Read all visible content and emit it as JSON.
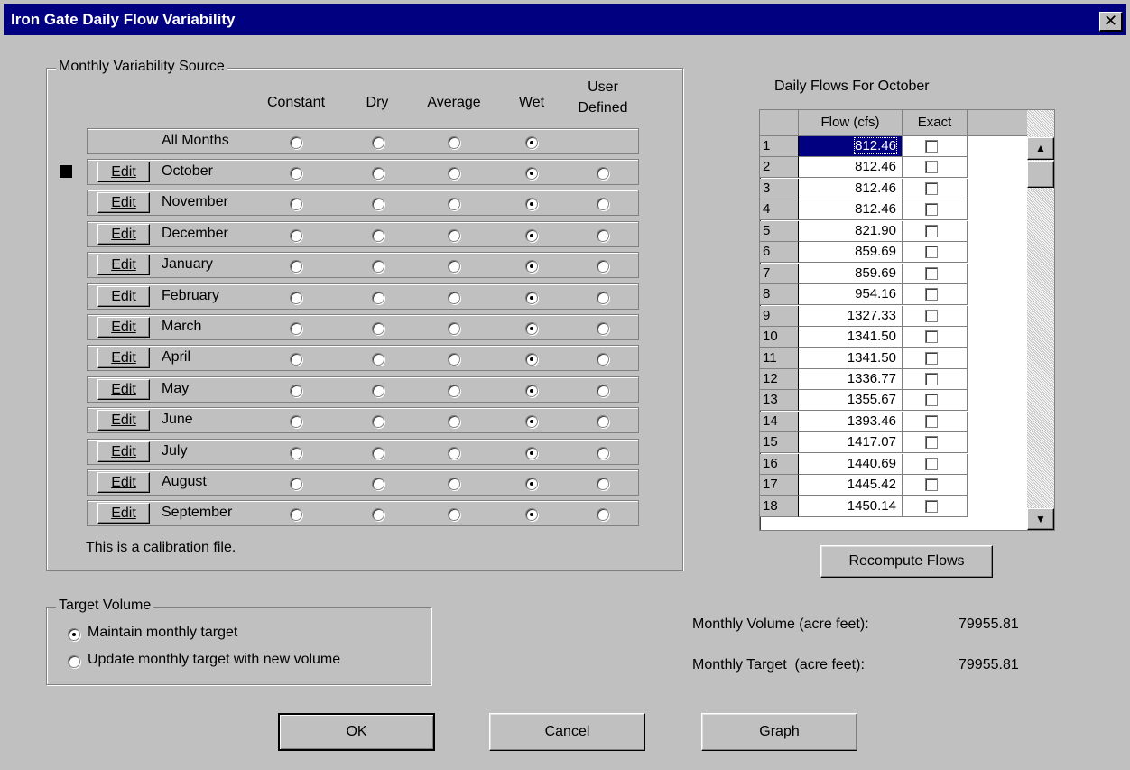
{
  "window": {
    "title": "Iron Gate Daily Flow Variability",
    "close_label": "✕"
  },
  "variability": {
    "group_label": "Monthly Variability Source",
    "columns": [
      "Constant",
      "Dry",
      "Average",
      "Wet",
      "User Defined"
    ],
    "column_user_line1": "User",
    "column_user_line2": "Defined",
    "all_months_label": "All Months",
    "edit_label": "Edit",
    "months": [
      "October",
      "November",
      "December",
      "January",
      "February",
      "March",
      "April",
      "May",
      "June",
      "July",
      "August",
      "September"
    ],
    "selected_source": "Wet",
    "current_month": "October",
    "note": "This is a calibration file."
  },
  "daily_flows": {
    "title": "Daily Flows For October",
    "col_flow": "Flow (cfs)",
    "col_exact": "Exact",
    "rows": [
      {
        "day": "1",
        "flow": "812.46"
      },
      {
        "day": "2",
        "flow": "812.46"
      },
      {
        "day": "3",
        "flow": "812.46"
      },
      {
        "day": "4",
        "flow": "812.46"
      },
      {
        "day": "5",
        "flow": "821.90"
      },
      {
        "day": "6",
        "flow": "859.69"
      },
      {
        "day": "7",
        "flow": "859.69"
      },
      {
        "day": "8",
        "flow": "954.16"
      },
      {
        "day": "9",
        "flow": "1327.33"
      },
      {
        "day": "10",
        "flow": "1341.50"
      },
      {
        "day": "11",
        "flow": "1341.50"
      },
      {
        "day": "12",
        "flow": "1336.77"
      },
      {
        "day": "13",
        "flow": "1355.67"
      },
      {
        "day": "14",
        "flow": "1393.46"
      },
      {
        "day": "15",
        "flow": "1417.07"
      },
      {
        "day": "16",
        "flow": "1440.69"
      },
      {
        "day": "17",
        "flow": "1445.42"
      },
      {
        "day": "18",
        "flow": "1450.14"
      }
    ],
    "recompute_label": "Recompute Flows"
  },
  "target_volume": {
    "group_label": "Target Volume",
    "option_maintain": "Maintain monthly target",
    "option_update": "Update monthly target with new volume",
    "selected": "maintain"
  },
  "summary": {
    "volume_label": "Monthly Volume (acre feet):",
    "volume_value": "79955.81",
    "target_label": "Monthly Target  (acre feet):",
    "target_value": "79955.81"
  },
  "buttons": {
    "ok": "OK",
    "cancel": "Cancel",
    "graph": "Graph"
  },
  "icons": {
    "scroll_up": "scroll-up-arrow-icon",
    "scroll_down": "scroll-down-arrow-icon"
  }
}
